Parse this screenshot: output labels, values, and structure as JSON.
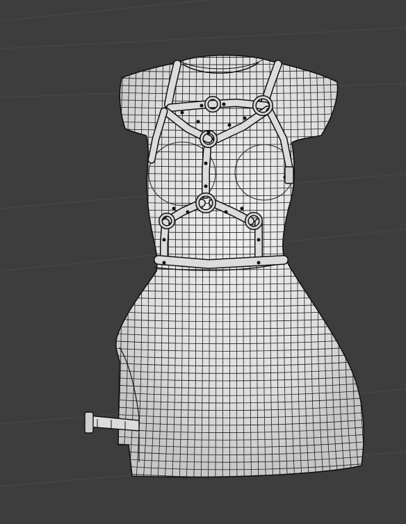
{
  "viewport": {
    "background_color": "#3d3d3d",
    "grid_color": "#4a4a4a",
    "mesh_fill_color": "#e9e9e9",
    "mesh_shade_color": "#cfcfcf",
    "wire_color": "#1b1b1b",
    "strap_color": "#dcdcdc",
    "object_description_icon": "wireframe-dress-with-harness"
  }
}
